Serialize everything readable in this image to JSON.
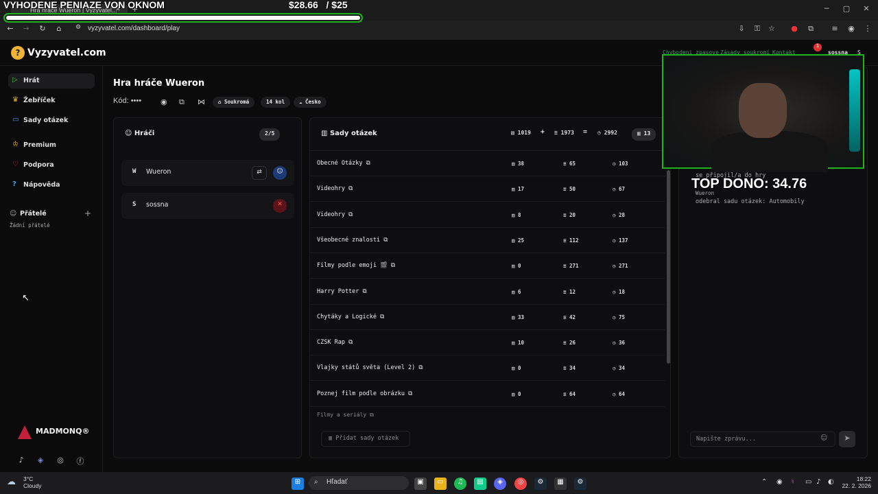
{
  "stream_overlay": {
    "title": "VYHODENE PENIAZE VON OKNOM",
    "amount": "$28.66",
    "goal": "/ $25",
    "progress_fraction": 1.0,
    "top_dono": "TOP DONO: 34.76"
  },
  "browser": {
    "tab_title": "Hra hráče Wueron | Vyzyvatel...",
    "url": "vyzyvatel.com/dashboard/play"
  },
  "app": {
    "logo": "Vyzyvatel.com",
    "top_links": [
      "Chybodeni zpasove",
      "Zásady soukromí",
      "Kontakt"
    ],
    "notification_count": "1",
    "user": "sossna",
    "user_initial": "S"
  },
  "sidebar": {
    "items": [
      {
        "label": "Hrát",
        "icon": "play-icon"
      },
      {
        "label": "Žebříček",
        "icon": "trophy-icon"
      },
      {
        "label": "Sady otázek",
        "icon": "book-icon"
      },
      {
        "label": "Premium",
        "icon": "crown-icon"
      },
      {
        "label": "Podpora",
        "icon": "heart-icon"
      },
      {
        "label": "Nápověda",
        "icon": "help-icon"
      }
    ],
    "friends_title": "Přátelé",
    "no_friends": "Žádní přátelé",
    "madmonq": "MADMONQ®"
  },
  "game": {
    "title": "Hra hráče Wueron",
    "code_label": "Kód:",
    "code_mask": "••••",
    "privacy": "Soukromá",
    "rounds": "14 kol",
    "language": "Česko"
  },
  "players": {
    "title": "Hráči",
    "count": "2/5",
    "list": [
      {
        "initial": "W",
        "name": "Wueron"
      },
      {
        "initial": "S",
        "name": "sossna"
      }
    ]
  },
  "question_sets": {
    "title": "Sady otázek",
    "total_a": "1019",
    "plus": "+",
    "total_b": "1973",
    "equals": "=",
    "total": "2992",
    "sets_count": "13",
    "rows": [
      {
        "name": "Obecné Otázky",
        "a": "38",
        "b": "65",
        "t": "103"
      },
      {
        "name": "Videohry",
        "a": "17",
        "b": "50",
        "t": "67"
      },
      {
        "name": "Videohry",
        "a": "8",
        "b": "20",
        "t": "28"
      },
      {
        "name": "Všeobecné znalosti",
        "a": "25",
        "b": "112",
        "t": "137"
      },
      {
        "name": "Filmy podle emoji 🎬",
        "a": "0",
        "b": "271",
        "t": "271"
      },
      {
        "name": "Harry Potter",
        "a": "6",
        "b": "12",
        "t": "18"
      },
      {
        "name": "Chytáky a Logické",
        "a": "33",
        "b": "42",
        "t": "75"
      },
      {
        "name": "CZSK Rap",
        "a": "10",
        "b": "26",
        "t": "36"
      },
      {
        "name": "Vlajky států světa (Level 2)",
        "a": "0",
        "b": "34",
        "t": "34"
      },
      {
        "name": "Poznej film podle obrázku",
        "a": "0",
        "b": "64",
        "t": "64"
      }
    ],
    "add_button": "Přidat sady otázek"
  },
  "chat": {
    "lines": [
      "se připojil/a do hry",
      "Wueron",
      "odebral sadu otázek: Automobily"
    ],
    "placeholder": "Napište zprávu..."
  },
  "taskbar": {
    "temp": "3°C",
    "weather": "Cloudy",
    "search": "Hľadať",
    "time": "18:22",
    "date": "22. 2. 2026"
  }
}
